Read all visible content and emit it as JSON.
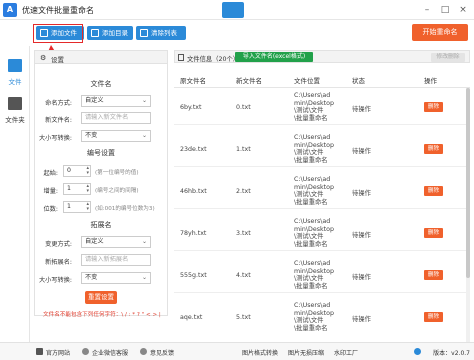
{
  "app": {
    "title": "优速文件批量重命名",
    "logo_text": "A"
  },
  "window": {
    "minimize": "–",
    "maximize": "□",
    "close": "×"
  },
  "toolbar": {
    "add_file": "添加文件",
    "add_dir": "添加目录",
    "clear": "清除列表",
    "start": "开始重命名"
  },
  "nav": [
    {
      "label": "文件"
    },
    {
      "label": "文件夹"
    }
  ],
  "settings": {
    "header": "设置",
    "sec_filename": "文件名",
    "naming_mode_label": "命名方式:",
    "naming_mode_value": "自定义",
    "new_name_label": "新文件名:",
    "new_name_placeholder": "请输入新文件名",
    "case_label": "大小写转换:",
    "case_value": "不变",
    "sec_number": "编号设置",
    "start_label": "起始:",
    "start_value": "0",
    "start_hint": "(第一位编号的值)",
    "step_label": "增量:",
    "step_value": "1",
    "step_hint": "(编号之间的间隔)",
    "digits_label": "位数:",
    "digits_value": "1",
    "digits_hint": "(如:001的编号位数为3)",
    "sec_ext": "拓展名",
    "ext_mode_label": "变更方式:",
    "ext_mode_value": "自定义",
    "new_ext_label": "新拓展名:",
    "new_ext_placeholder": "请输入新拓展名",
    "ext_case_label": "大小写转换:",
    "ext_case_value": "不变",
    "reset": "重置设置",
    "warning": "文件名不能包含下列任何字符：\\ / : * ? \" < > |"
  },
  "filelist": {
    "title": "文件信息（20个）",
    "import_btn": "导入文件名(excel格式)",
    "rename_btn": "修改删除",
    "columns": [
      "原文件名",
      "新文件名",
      "文件位置",
      "状态",
      "操作"
    ],
    "rows": [
      {
        "orig": "6by.txt",
        "new": "0.txt",
        "loc1": "C:\\Users\\ad",
        "loc2": "min\\Desktop",
        "loc3": "\\测试\\文件",
        "loc4": "\\批量重命名",
        "status": "待操作",
        "action": "删除"
      },
      {
        "orig": "23de.txt",
        "new": "1.txt",
        "loc1": "C:\\Users\\ad",
        "loc2": "min\\Desktop",
        "loc3": "\\测试\\文件",
        "loc4": "\\批量重命名",
        "status": "待操作",
        "action": "删除"
      },
      {
        "orig": "46hb.txt",
        "new": "2.txt",
        "loc1": "C:\\Users\\ad",
        "loc2": "min\\Desktop",
        "loc3": "\\测试\\文件",
        "loc4": "\\批量重命名",
        "status": "待操作",
        "action": "删除"
      },
      {
        "orig": "78yh.txt",
        "new": "3.txt",
        "loc1": "C:\\Users\\ad",
        "loc2": "min\\Desktop",
        "loc3": "\\测试\\文件",
        "loc4": "\\批量重命名",
        "status": "待操作",
        "action": "删除"
      },
      {
        "orig": "555g.txt",
        "new": "4.txt",
        "loc1": "C:\\Users\\ad",
        "loc2": "min\\Desktop",
        "loc3": "\\测试\\文件",
        "loc4": "\\批量重命名",
        "status": "待操作",
        "action": "删除"
      },
      {
        "orig": "aqe.txt",
        "new": "5.txt",
        "loc1": "C:\\Users\\ad",
        "loc2": "min\\Desktop",
        "loc3": "\\测试\\文件",
        "loc4": "\\批量重命名",
        "status": "待操作",
        "action": "删除"
      }
    ]
  },
  "statusbar": {
    "website": "官方网站",
    "wechat": "企业微信客服",
    "feedback": "意见反馈",
    "img_convert": "图片格式转换",
    "img_compress": "图片无损压缩",
    "watermark": "水印工厂",
    "version": "版本：v2.0.7"
  },
  "colors": {
    "accent": "#2b8ad8",
    "primary_action": "#f0612c",
    "import": "#22a14a",
    "highlight": "#e42a2a"
  }
}
